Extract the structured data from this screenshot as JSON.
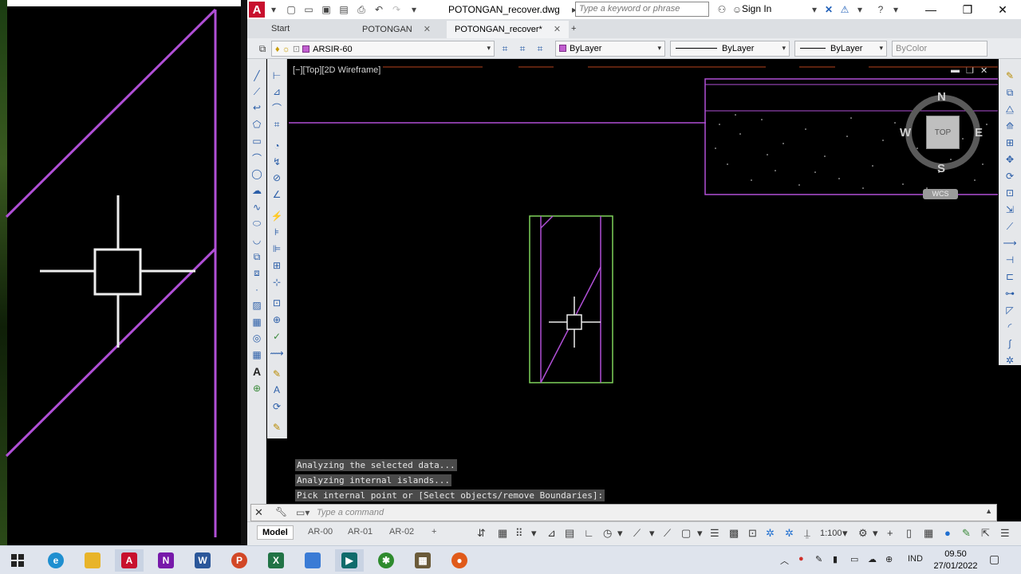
{
  "app": {
    "file_title": "POTONGAN_recover.dwg",
    "search_placeholder": "Type a keyword or phrase",
    "sign_in": "Sign In"
  },
  "tabs": [
    {
      "label": "Start"
    },
    {
      "label": "POTONGAN"
    },
    {
      "label": "POTONGAN_recover*"
    }
  ],
  "properties": {
    "layer": "ARSIR-60",
    "color": "ByLayer",
    "linetype": "ByLayer",
    "lineweight": "ByLayer",
    "plotstyle": "ByColor"
  },
  "viewport": {
    "label": "[−][Top][2D Wireframe]"
  },
  "viewcube": {
    "north": "N",
    "south": "S",
    "east": "E",
    "west": "W",
    "face": "TOP",
    "wcs": "WCS"
  },
  "command_history": [
    "Analyzing the selected data...",
    "Analyzing internal islands...",
    "Pick internal point or [Select objects/remove Boundaries]:"
  ],
  "command_placeholder": "Type a command",
  "layout_tabs": [
    {
      "label": "Model"
    },
    {
      "label": "AR-00"
    },
    {
      "label": "AR-01"
    },
    {
      "label": "AR-02"
    }
  ],
  "status": {
    "scale": "1:100"
  },
  "taskbar": {
    "language": "IND",
    "time": "09.50",
    "date": "27/01/2022"
  },
  "colors": {
    "magenta_line": "#b04fd6",
    "green_line": "#7fd35a",
    "autocad_red": "#c8102e"
  }
}
